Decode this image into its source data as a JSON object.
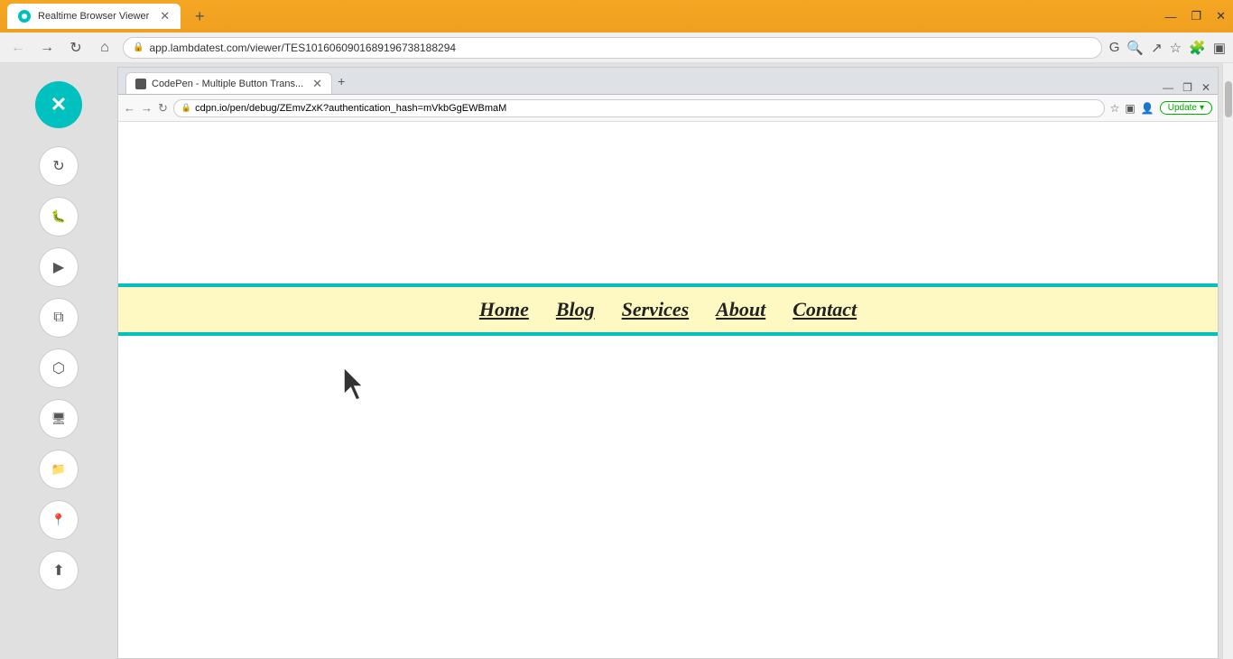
{
  "outerBrowser": {
    "tab": {
      "title": "Realtime Browser Viewer",
      "favicon_color": "#00bfbf"
    },
    "addressBar": {
      "url": "app.lambdatest.com/viewer/TES101606090168919673818829​4",
      "lock_icon": "🔒"
    },
    "windowControls": {
      "minimize": "—",
      "maximize": "❐",
      "close": "✕"
    }
  },
  "innerBrowser": {
    "tab": {
      "title": "CodePen - Multiple Button Trans...",
      "favicon": "CP"
    },
    "addressBar": {
      "url": "cdpn.io/pen/debug/ZEmvZxK?authentication_hash=mVkbGgEWBmaM",
      "update_label": "Update"
    }
  },
  "sidebar": {
    "close_icon": "✕",
    "icons": [
      {
        "name": "sync-icon",
        "symbol": "↻"
      },
      {
        "name": "bug-icon",
        "symbol": "🐛"
      },
      {
        "name": "video-icon",
        "symbol": "▶"
      },
      {
        "name": "layers-icon",
        "symbol": "⧉"
      },
      {
        "name": "cube-icon",
        "symbol": "⬡"
      },
      {
        "name": "monitor-icon",
        "symbol": "🖥"
      },
      {
        "name": "folder-icon",
        "symbol": "📁"
      },
      {
        "name": "location-icon",
        "symbol": "📍"
      },
      {
        "name": "upload-icon",
        "symbol": "⬆"
      }
    ]
  },
  "navBar": {
    "items": [
      {
        "label": "Home"
      },
      {
        "label": "Blog"
      },
      {
        "label": "Services"
      },
      {
        "label": "About"
      },
      {
        "label": "Contact"
      }
    ]
  }
}
